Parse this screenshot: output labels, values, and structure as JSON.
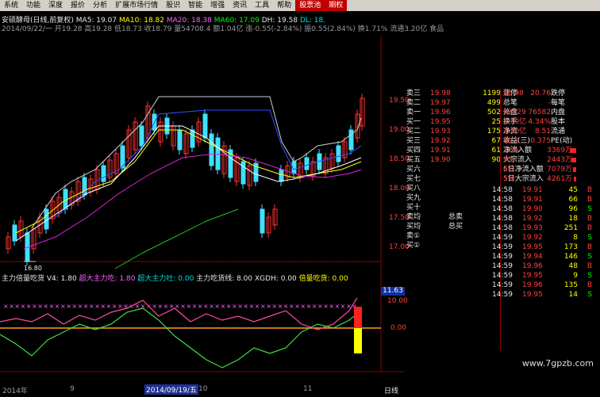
{
  "menu": [
    "系统",
    "功能",
    "深度",
    "报价",
    "分析",
    "扩展市场行情",
    "股识",
    "智能",
    "增强",
    "资讯",
    "工具",
    "帮助"
  ],
  "menu_red": [
    "股票池",
    "期权"
  ],
  "header": {
    "name": "安硕酵母(日线,前复权)",
    "ma5": "MA5: 19.07",
    "ma10": "MA10: 18.82",
    "ma20": "MA20: 18.38",
    "ma60": "MA60: 17.09",
    "dh": "DH: 19.58",
    "last": "DL: 18.",
    "line2": "2014/09/22/一 开19.28 高19.28 低18.73 收18.79 量54708.4 额1.04亿 涨-0.55(-2.84%) 振0.55(2.84%) 换1.71% 流通3.20亿 食品"
  },
  "price_axis": [
    "19.50",
    "19.00",
    "18.50",
    "18.00",
    "17.50",
    "17.00"
  ],
  "low_label": "16.80",
  "indicator": {
    "label": "主力倍量吃货 V4: 1.80",
    "a": "超大主力吃: 1.80",
    "b": "超大主力吐: 0.00",
    "c": "主力吃货线: 8.00",
    "d": "XGDH: 0.00",
    "e": "倍量吃货: 0.00",
    "axis": [
      "11.63",
      "10.00",
      "0.00"
    ]
  },
  "dates": [
    "2014年",
    "9",
    "2014/09/19/五",
    "10",
    "11"
  ],
  "bottom_right": "日线",
  "watermark": "www.7gpzb.com",
  "book": {
    "sell": [
      {
        "l": "卖三",
        "p": "19.98",
        "v": "1199"
      },
      {
        "l": "卖二",
        "p": "19.97",
        "v": "499"
      },
      {
        "l": "卖一",
        "p": "19.96",
        "v": "502"
      }
    ],
    "buy": [
      {
        "l": "买一",
        "p": "19.95",
        "v": "25"
      },
      {
        "l": "买二",
        "p": "19.93",
        "v": "175"
      },
      {
        "l": "买三",
        "p": "19.92",
        "v": "67"
      },
      {
        "l": "买四",
        "p": "19.91",
        "v": "61"
      },
      {
        "l": "买五",
        "p": "19.90",
        "v": "90"
      }
    ],
    "more": [
      "买六",
      "买七",
      "买八",
      "买九",
      "买十",
      "卖均",
      "买均",
      "卖①",
      "买①"
    ],
    "avg_sell": "总卖",
    "avg_buy": "总买"
  },
  "stats": [
    {
      "a": "涨停",
      "b": "20.76",
      "c": "跌停",
      "d": "16.98"
    },
    {
      "a": "总笔",
      "b": "-",
      "c": "每笔",
      "d": "-"
    },
    {
      "a": "外盘",
      "b": "76582",
      "c": "内盘",
      "d": "62129"
    },
    {
      "a": "换手",
      "b": "4.34%",
      "c": "股本",
      "d": "3.30亿"
    },
    {
      "a": "净资",
      "b": "8.51",
      "c": "流通",
      "d": "3.20亿"
    },
    {
      "a": "收益(三)",
      "b": "0.375",
      "c": "PE(动)",
      "d": "39.9"
    }
  ],
  "flows": [
    {
      "a": "净流入额",
      "b": "3369万",
      "c": "12%"
    },
    {
      "a": "大宗流入",
      "b": "2443万",
      "c": "9%"
    },
    {
      "a": "5日净流入额",
      "b": "7079万",
      "c": "6%"
    },
    {
      "a": "5日大宗流入",
      "b": "4261万",
      "c": "5%"
    }
  ],
  "ticks": [
    {
      "t": "14:58",
      "p": "19.91",
      "v": "45",
      "s": "B"
    },
    {
      "t": "14:58",
      "p": "19.91",
      "v": "66",
      "s": "B"
    },
    {
      "t": "14:58",
      "p": "19.90",
      "v": "96",
      "s": "S"
    },
    {
      "t": "14:58",
      "p": "19.92",
      "v": "18",
      "s": "B"
    },
    {
      "t": "14:58",
      "p": "19.93",
      "v": "251",
      "s": "B"
    },
    {
      "t": "14:59",
      "p": "19.92",
      "v": "8",
      "s": "S"
    },
    {
      "t": "14:59",
      "p": "19.95",
      "v": "173",
      "s": "B"
    },
    {
      "t": "14:59",
      "p": "19.94",
      "v": "146",
      "s": "S"
    },
    {
      "t": "14:59",
      "p": "19.96",
      "v": "48",
      "s": "B"
    },
    {
      "t": "14:59",
      "p": "19.95",
      "v": "9",
      "s": "S"
    },
    {
      "t": "14:59",
      "p": "19.96",
      "v": "135",
      "s": "B"
    },
    {
      "t": "14:59",
      "p": "19.95",
      "v": "14",
      "s": "S"
    }
  ]
}
